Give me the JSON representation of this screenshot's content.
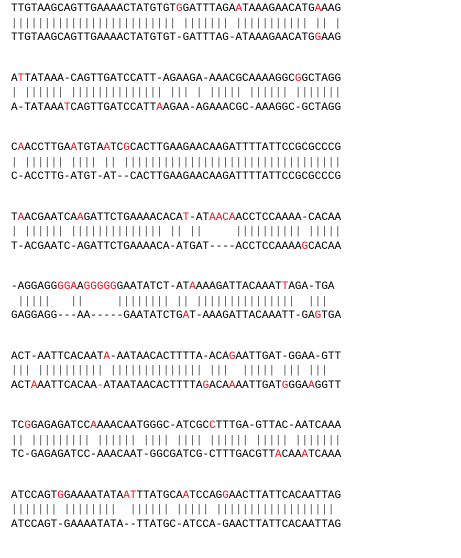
{
  "highlight_color": "#e8141e",
  "blocks": [
    {
      "top": {
        "text": "TTGTAAGCAGTTGAAAACTATGTGTGGATTTAGAATAAAGAACATGAAAG",
        "highlights": [
          25,
          34,
          46
        ]
      },
      "match": "||||||||||||||||||||||||| ||||||| ||||||||||| || |",
      "bottom": {
        "text": "TTGTAAGCAGTTGAAAACTATGTGT-GATTTAG-ATAAAGAACATGGAAG",
        "highlights": [
          46
        ]
      }
    },
    {
      "top": {
        "text": "ATTATAAA-CAGTTGATCCATT-AGAAGA-AAACGCAAAAGGCGGCTAGG",
        "highlights": [
          1,
          43
        ]
      },
      "match": "| |||||| |||||||||||||| ||| | ||||| |||||| |||||||",
      "bottom": {
        "text": "A-TATAAATCAGTTGATCCATTAAGAA-AGAAACGC-AAAGGC-GCTAGG",
        "highlights": [
          8,
          22
        ]
      }
    },
    {
      "top": {
        "text": "CAACCTTGAATGTAATCGCACTTGAAGAACAAGATTTTATTCCGCGCCCG",
        "highlights": [
          1,
          9,
          14,
          17
        ]
      },
      "match": "| |||||| |||| || |||||||||||||||||||||||||||||||||",
      "bottom": {
        "text": "C-ACCTTG-ATGT-AT--CACTTGAAGAACAAGATTTTATTCCGCGCCCG",
        "highlights": []
      }
    },
    {
      "top": {
        "text": "TAACGAATCAAGATTCTGAAAACACAT-ATAACAACCTCCAAAA-CACAA",
        "highlights": [
          1,
          10,
          26,
          30,
          31,
          32,
          33
        ]
      },
      "match": "| |||||| |||||||||||||| || ||     |||||||||| |||||",
      "bottom": {
        "text": "T-ACGAATC-AGATTCTGAAAACA-ATGAT----ACCTCCAAAAGCACAA",
        "highlights": [
          44
        ]
      }
    },
    {
      "top": {
        "text": "-AGGAGGGGAAGGGGGGAATATCT-ATAAAAGATTACAAATTAGA-TGA",
        "highlights": [
          7,
          8,
          9,
          11,
          12,
          13,
          14,
          15,
          27,
          41
        ]
      },
      "match": " |||||   ||     |||||||| || |||||||||||||||  |||",
      "bottom": {
        "text": "GAGGAGG---AA-----GAATATCTGAT-AAAGATTACAAATT-GAGTGA",
        "highlights": [
          26,
          46
        ]
      }
    },
    {
      "top": {
        "text": "ACT-AATTCACAATA-AATAACACTTTTA-ACAGAATTGAT-GGAA-GTT",
        "highlights": [
          14,
          33
        ]
      },
      "match": "||| |||||||||| |||||||||||||| |||  ||||| ||| |||",
      "bottom": {
        "text": "ACTAAATTCACAA-ATAATAACACTTTTAGACAAAATTGATGGGAAGGTT",
        "highlights": [
          3,
          13,
          29,
          33,
          41,
          45
        ]
      }
    },
    {
      "top": {
        "text": "TCGGAGAGATCCAAAACAATGGGC-ATCGCCTTTGA-GTTAC-AATCAAA",
        "highlights": [
          2,
          12,
          30
        ]
      },
      "match": "|| ||||||||| |||||| |||| |||| |||||| ||||| |||||||",
      "bottom": {
        "text": "TC-GAGAGATCC-AAACAAT-GGCGATCG-CTTTGACGTTACAAATCAAA",
        "highlights": [
          40,
          44
        ]
      }
    },
    {
      "top": {
        "text": "ATCCAGTGGAAAATATAATTTATGCAATCCAGGAACTTATTCACAATTAG",
        "highlights": [
          7,
          17,
          18,
          26,
          32
        ]
      },
      "match": "||||||| ||||||||  |||||| ||||| ||||||||||||||||||",
      "bottom": {
        "text": "ATCCAGT-GAAAATATA--TTATGC-ATCCA-GAACTTATTCACAATTAG",
        "highlights": []
      }
    }
  ]
}
